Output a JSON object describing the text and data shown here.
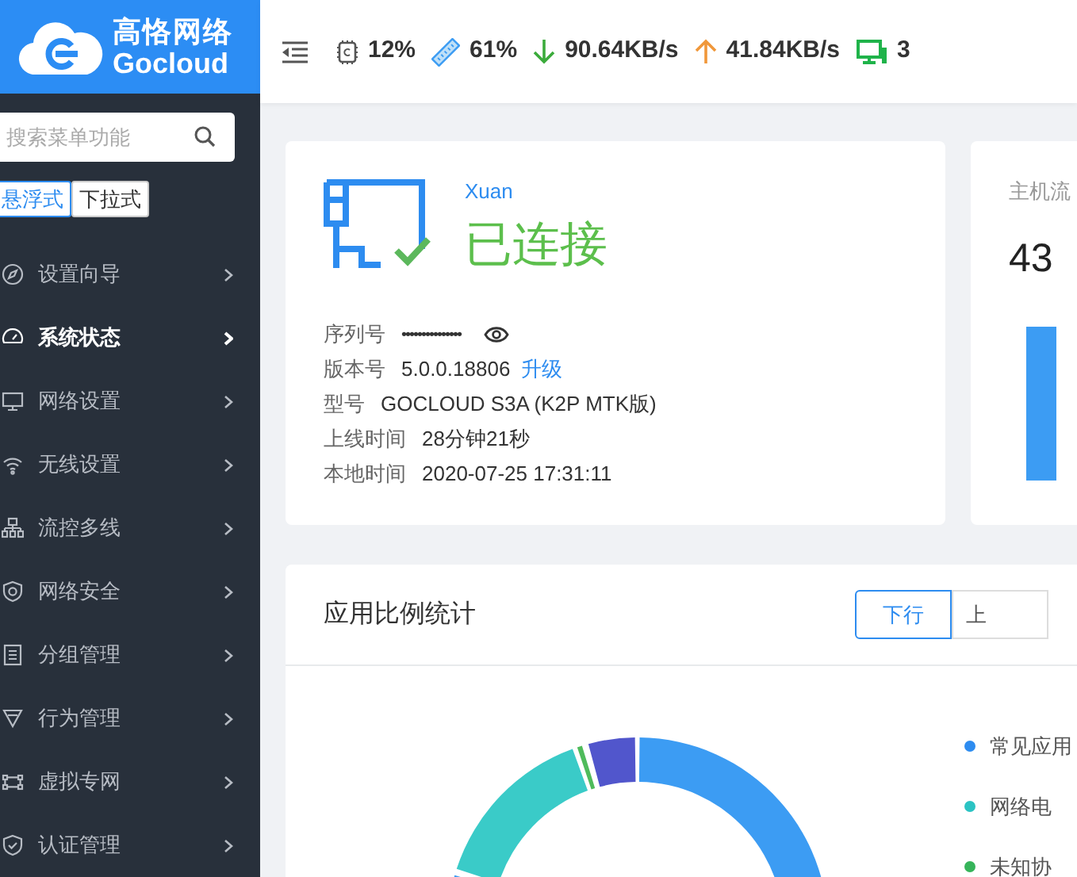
{
  "logo": {
    "name": "高恪网络",
    "latin": "Gocloud"
  },
  "topbar": {
    "stats": [
      {
        "kind": "cpu",
        "value": "12%"
      },
      {
        "kind": "memory",
        "value": "61%"
      },
      {
        "kind": "download",
        "value": "90.64KB/s"
      },
      {
        "kind": "upload",
        "value": "41.84KB/s"
      },
      {
        "kind": "devices",
        "value": "3"
      }
    ]
  },
  "sidebar": {
    "search": {
      "placeholder": "搜索菜单功能"
    },
    "modes": [
      {
        "label": "悬浮式",
        "selected": true
      },
      {
        "label": "下拉式",
        "selected": false
      }
    ],
    "items": [
      {
        "label": "设置向导",
        "selected": false
      },
      {
        "label": "系统状态",
        "selected": true
      },
      {
        "label": "网络设置",
        "selected": false
      },
      {
        "label": "无线设置",
        "selected": false
      },
      {
        "label": "流控多线",
        "selected": false
      },
      {
        "label": "网络安全",
        "selected": false
      },
      {
        "label": "分组管理",
        "selected": false
      },
      {
        "label": "行为管理",
        "selected": false
      },
      {
        "label": "虚拟专网",
        "selected": false
      },
      {
        "label": "认证管理",
        "selected": false
      }
    ]
  },
  "status_card": {
    "name": "Xuan",
    "status": "已连接",
    "info": [
      {
        "kind": "secret",
        "label": "序列号",
        "value": "•••••••••••••••"
      },
      {
        "kind": "link",
        "label": "版本号",
        "value": "5.0.0.18806",
        "link": "升级"
      },
      {
        "kind": "text",
        "label": "型号",
        "value": "GOCLOUD S3A (K2P MTK版)"
      },
      {
        "kind": "text",
        "label": "上线时间",
        "value": "28分钟21秒"
      },
      {
        "kind": "text",
        "label": "本地时间",
        "value": "2020-07-25 17:31:11"
      }
    ]
  },
  "host_traffic": {
    "title": "主机流",
    "value": "43"
  },
  "app_stats": {
    "title": "应用比例统计",
    "directions": [
      {
        "label": "下行",
        "selected": true
      },
      {
        "label": "上",
        "selected": false
      }
    ],
    "legend": [
      {
        "label": "常见应用",
        "color": "#2d8cf0"
      },
      {
        "label": "网络电",
        "color": "#2bc3c3"
      },
      {
        "label": "未知协",
        "color": "#36b45a"
      }
    ]
  }
}
